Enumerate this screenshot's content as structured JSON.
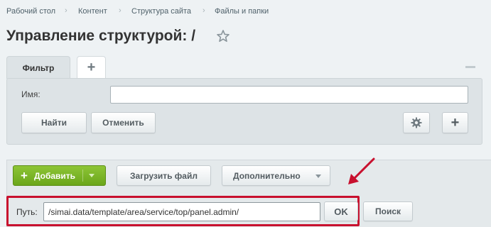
{
  "breadcrumb": {
    "items": [
      "Рабочий стол",
      "Контент",
      "Структура сайта",
      "Файлы и папки"
    ]
  },
  "page": {
    "title": "Управление структурой: /"
  },
  "filter": {
    "tab_label": "Фильтр",
    "add_tab_icon": "plus-icon",
    "name_label": "Имя:",
    "name_value": "",
    "find_label": "Найти",
    "cancel_label": "Отменить",
    "settings_icon": "gear-icon",
    "add_field_icon": "plus-icon"
  },
  "toolbar": {
    "add_label": "Добавить",
    "upload_label": "Загрузить файл",
    "more_label": "Дополнительно"
  },
  "path_bar": {
    "label": "Путь:",
    "value": "/simai.data/template/area/service/top/panel.admin/",
    "ok_label": "OK",
    "search_label": "Поиск"
  },
  "colors": {
    "accent_green": "#7bb526",
    "annotation_red": "#c8102e",
    "panel_bg": "#dde3e6"
  }
}
